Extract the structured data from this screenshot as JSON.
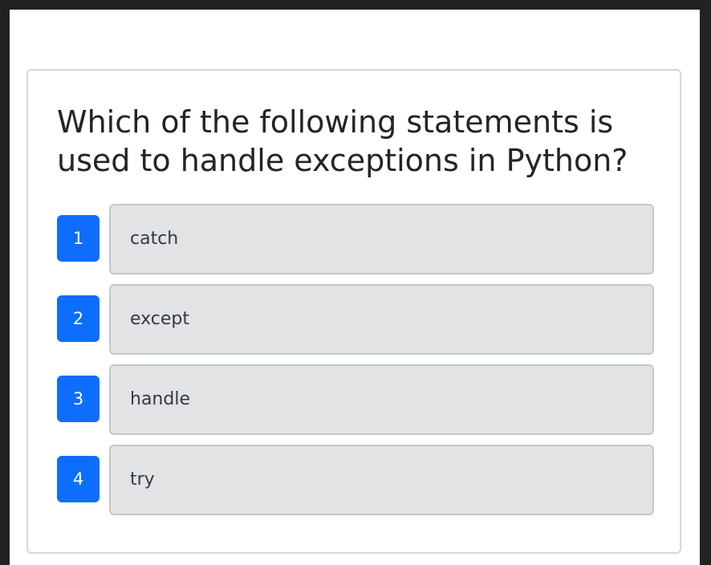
{
  "quiz": {
    "question": "Which of the following statements is used to handle exceptions in Python?",
    "options": [
      {
        "number": "1",
        "text": "catch"
      },
      {
        "number": "2",
        "text": "except"
      },
      {
        "number": "3",
        "text": "handle"
      },
      {
        "number": "4",
        "text": "try"
      }
    ]
  },
  "colors": {
    "accent": "#0d6efd",
    "option_background": "#e2e3e5",
    "option_border": "#c4c7cb",
    "frame": "#222222"
  }
}
